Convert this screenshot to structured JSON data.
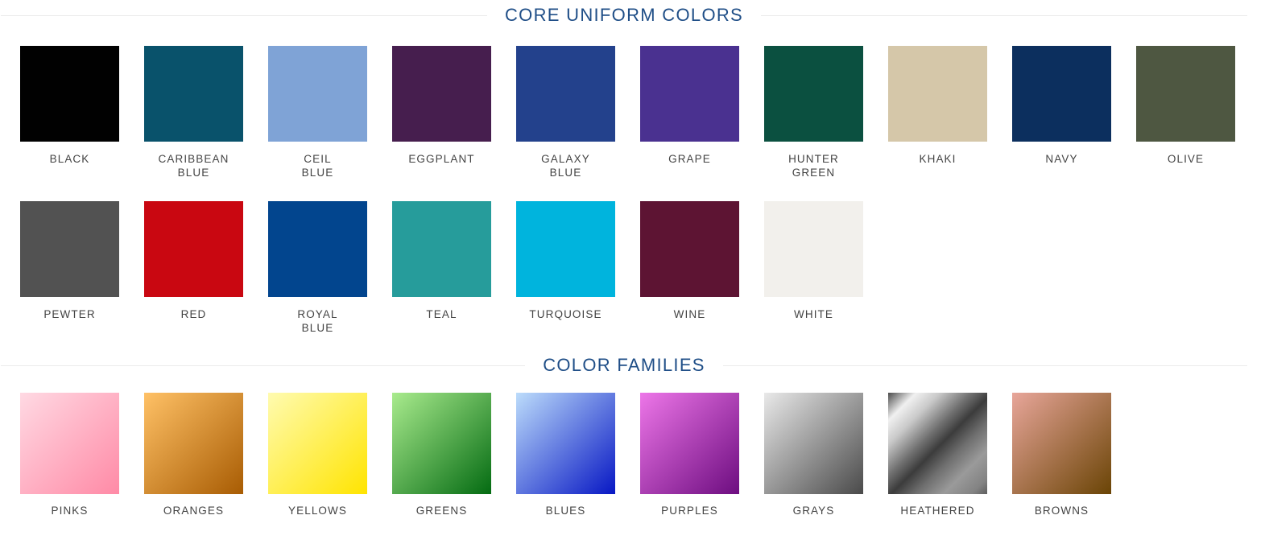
{
  "sections": [
    {
      "id": "core-uniform-colors",
      "title": "CORE UNIFORM COLORS",
      "rows": [
        {
          "id": "core-row-1",
          "swatches": [
            {
              "label": "BLACK",
              "color": "#010101",
              "fill": "solid"
            },
            {
              "label": "CARIBBEAN\nBLUE",
              "color": "#09526b",
              "fill": "solid"
            },
            {
              "label": "CEIL\nBLUE",
              "color": "#7fa3d6",
              "fill": "solid"
            },
            {
              "label": "EGGPLANT",
              "color": "#461e4e",
              "fill": "solid"
            },
            {
              "label": "GALAXY\nBLUE",
              "color": "#23418c",
              "fill": "solid"
            },
            {
              "label": "GRAPE",
              "color": "#4a3190",
              "fill": "solid"
            },
            {
              "label": "HUNTER\nGREEN",
              "color": "#0b5040",
              "fill": "solid"
            },
            {
              "label": "KHAKI",
              "color": "#d5c7a9",
              "fill": "solid"
            },
            {
              "label": "NAVY",
              "color": "#0c2f5e",
              "fill": "solid"
            },
            {
              "label": "OLIVE",
              "color": "#4e5741",
              "fill": "solid"
            }
          ]
        },
        {
          "id": "core-row-2",
          "swatches": [
            {
              "label": "PEWTER",
              "color": "#525252",
              "fill": "solid"
            },
            {
              "label": "RED",
              "color": "#c90711",
              "fill": "solid"
            },
            {
              "label": "ROYAL\nBLUE",
              "color": "#02458e",
              "fill": "solid"
            },
            {
              "label": "TEAL",
              "color": "#269c9b",
              "fill": "solid"
            },
            {
              "label": "TURQUOISE",
              "color": "#00b4dd",
              "fill": "solid"
            },
            {
              "label": "WINE",
              "color": "#5d1433",
              "fill": "solid"
            },
            {
              "label": "WHITE",
              "color": "#f2f0ec",
              "fill": "solid"
            }
          ]
        }
      ]
    },
    {
      "id": "color-families",
      "title": "COLOR FAMILIES",
      "rows": [
        {
          "id": "families-row-1",
          "swatches": [
            {
              "label": "PINKS",
              "fill": "gradient",
              "gradient_from": "#ffd9e3",
              "gradient_to": "#ff8aa6"
            },
            {
              "label": "ORANGES",
              "fill": "gradient",
              "gradient_from": "#ffc166",
              "gradient_to": "#a85c03"
            },
            {
              "label": "YELLOWS",
              "fill": "gradient",
              "gradient_from": "#fffbb0",
              "gradient_to": "#ffe400"
            },
            {
              "label": "GREENS",
              "fill": "gradient",
              "gradient_from": "#a9eb8d",
              "gradient_to": "#046b12"
            },
            {
              "label": "BLUES",
              "fill": "gradient",
              "gradient_from": "#bcdcfb",
              "gradient_to": "#0717c4"
            },
            {
              "label": "PURPLES",
              "fill": "gradient",
              "gradient_from": "#ed76e8",
              "gradient_to": "#6d0d80"
            },
            {
              "label": "GRAYS",
              "fill": "gradient",
              "gradient_from": "#e9e9e9",
              "gradient_to": "#4a4a4a"
            },
            {
              "label": "HEATHERED",
              "fill": "heathered",
              "gradient_from": "#efefef",
              "gradient_to": "#6c6c6c"
            },
            {
              "label": "BROWNS",
              "fill": "gradient",
              "gradient_from": "#e8a69a",
              "gradient_to": "#6a4405"
            }
          ]
        }
      ]
    }
  ],
  "colors": {
    "section_title": "#1f4e87",
    "rule": "#eaeaea",
    "label_text": "#434343",
    "page_background": "#ffffff"
  }
}
